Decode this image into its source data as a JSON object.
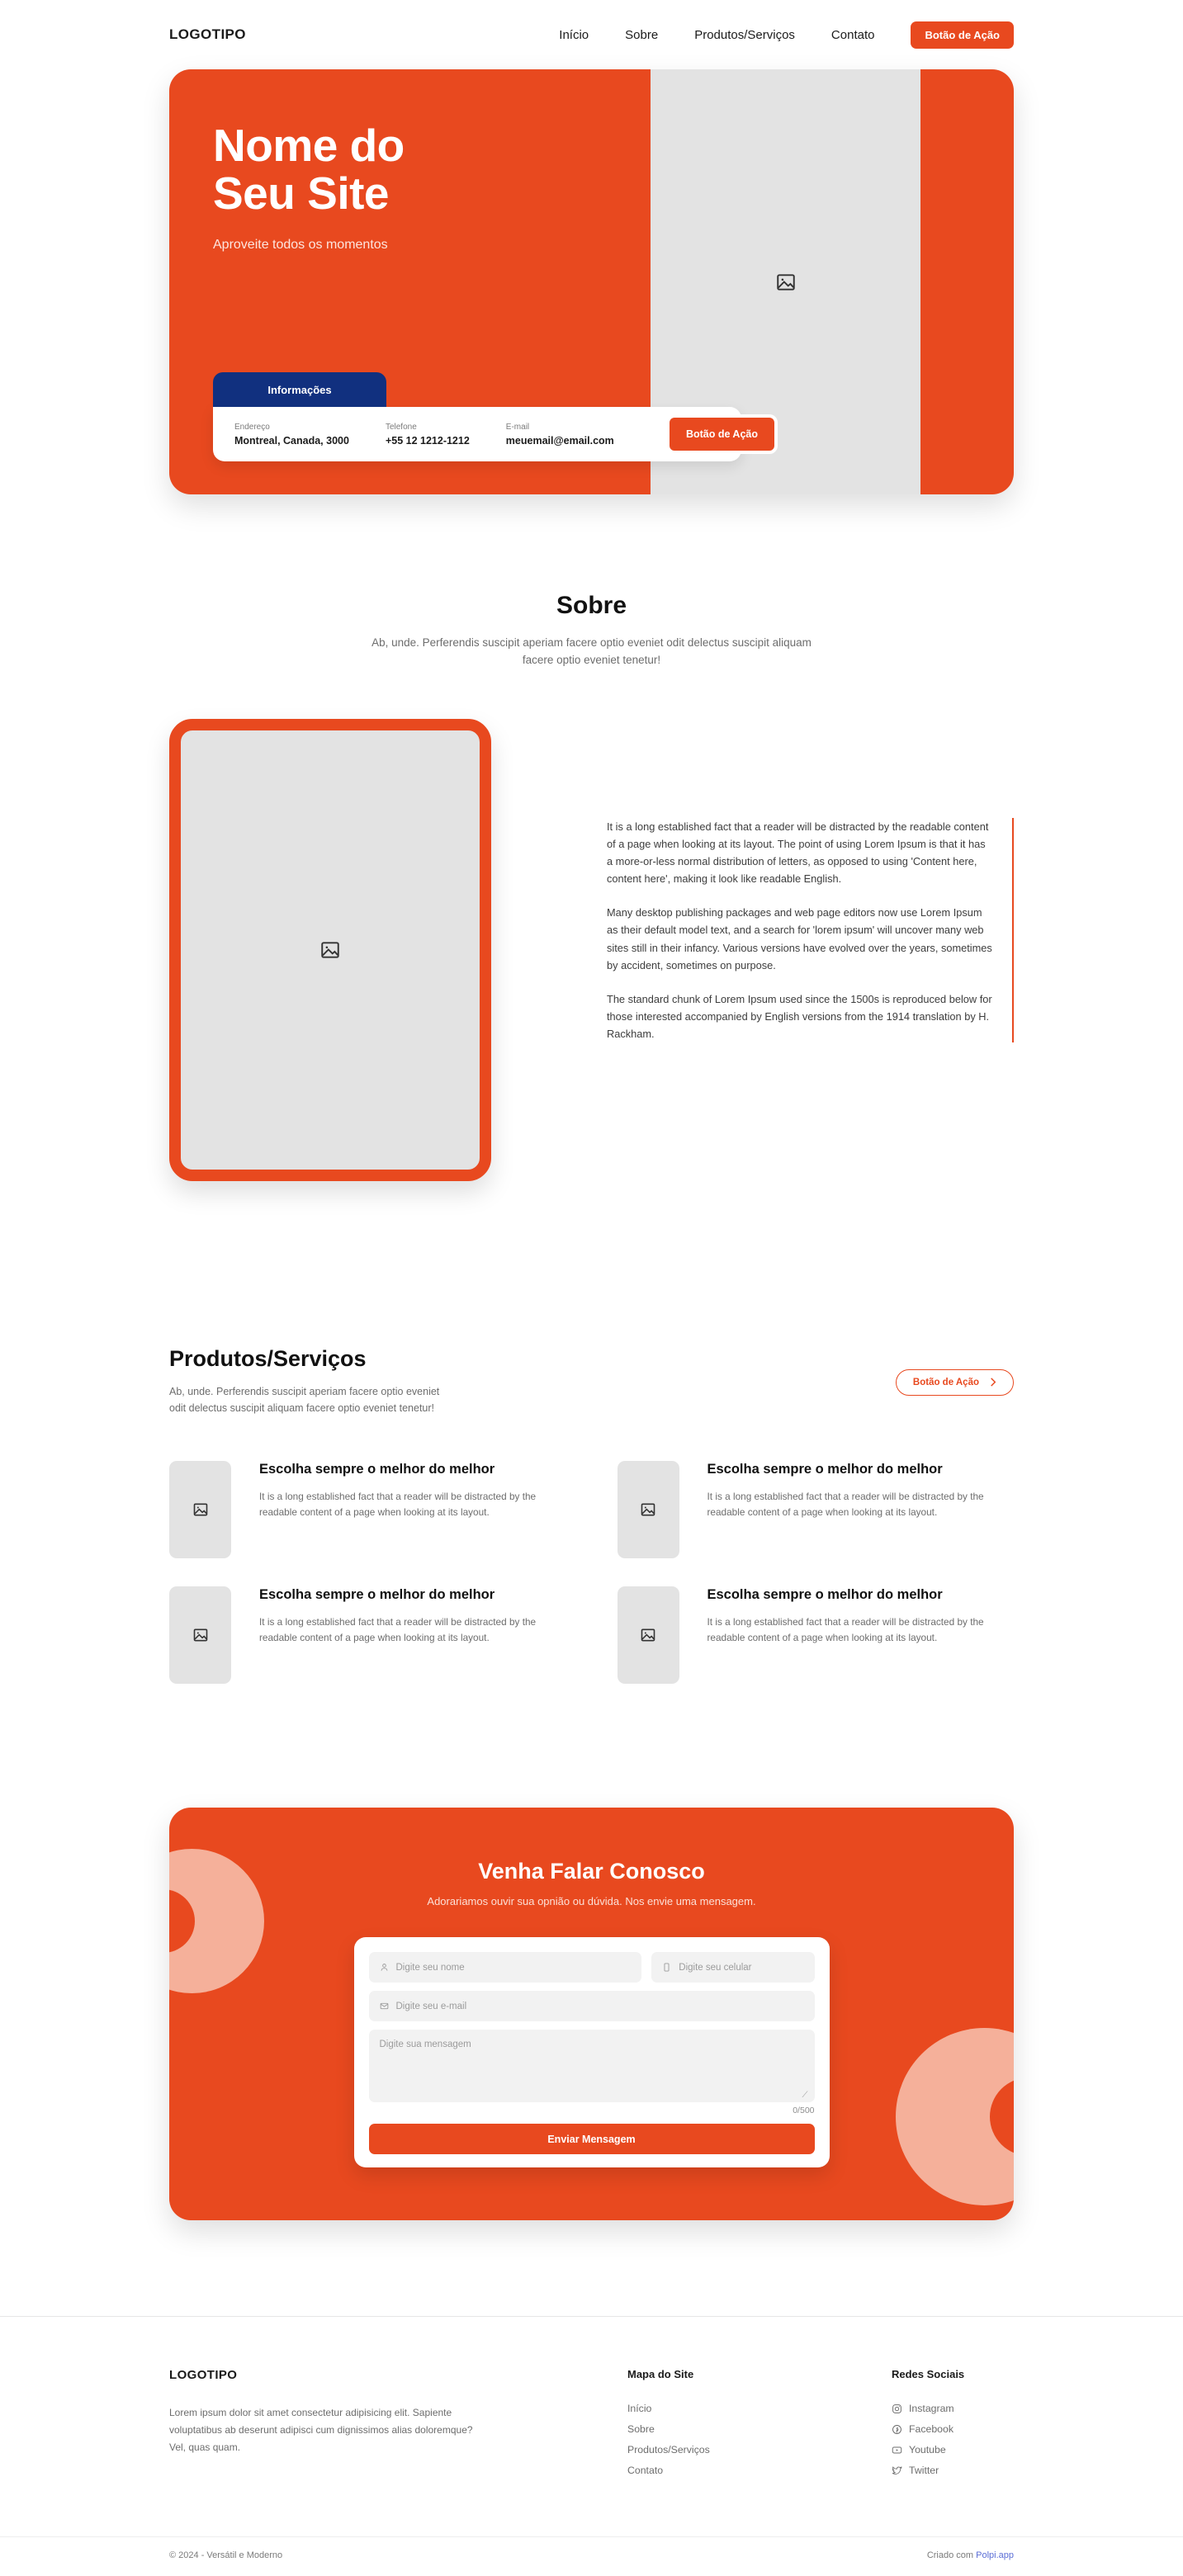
{
  "brand": {
    "accent": "#e8491f",
    "navy": "#11307f",
    "placeholder_gray": "#e3e3e3"
  },
  "header": {
    "logo": "LOGOTIPO",
    "nav": [
      {
        "label": "Início"
      },
      {
        "label": "Sobre"
      },
      {
        "label": "Produtos/Serviços"
      },
      {
        "label": "Contato"
      }
    ],
    "cta_label": "Botão de Ação"
  },
  "hero": {
    "title": "Nome do\nSeu Site",
    "subtitle": "Aproveite todos os momentos",
    "image_icon": "image-placeholder-icon",
    "info_tab_label": "Informações",
    "info_items": [
      {
        "label": "Endereço",
        "value": "Montreal, Canada, 3000"
      },
      {
        "label": "Telefone",
        "value": "+55 12 1212-1212"
      },
      {
        "label": "E-mail",
        "value": "meuemail@email.com"
      }
    ],
    "cta_label": "Botão de Ação"
  },
  "sobre": {
    "title": "Sobre",
    "subtitle": "Ab, unde. Perferendis suscipit aperiam facere optio eveniet odit delectus suscipit aliquam facere optio eveniet tenetur!",
    "image_icon": "image-placeholder-icon",
    "paragraphs": [
      "It is a long established fact that a reader will be distracted by the readable content of a page when looking at its layout. The point of using Lorem Ipsum is that it has a more-or-less normal distribution of letters, as opposed to using 'Content here, content here', making it look like readable English.",
      "Many desktop publishing packages and web page editors now use Lorem Ipsum as their default model text, and a search for 'lorem ipsum' will uncover many web sites still in their infancy. Various versions have evolved over the years, sometimes by accident, sometimes on purpose.",
      "The standard chunk of Lorem Ipsum used since the 1500s is reproduced below for those interested accompanied by English versions from the 1914 translation by H. Rackham."
    ]
  },
  "produtos": {
    "title": "Produtos/Serviços",
    "subtitle": "Ab, unde. Perferendis suscipit aperiam facere optio eveniet odit delectus suscipit aliquam facere optio eveniet tenetur!",
    "cta_label": "Botão de Ação",
    "cards": [
      {
        "title": "Escolha sempre o melhor do melhor",
        "body": "It is a long established fact that a reader will be distracted by the readable content of a page when looking at its layout."
      },
      {
        "title": "Escolha sempre o melhor do melhor",
        "body": "It is a long established fact that a reader will be distracted by the readable content of a page when looking at its layout."
      },
      {
        "title": "Escolha sempre o melhor do melhor",
        "body": "It is a long established fact that a reader will be distracted by the readable content of a page when looking at its layout."
      },
      {
        "title": "Escolha sempre o melhor do melhor",
        "body": "It is a long established fact that a reader will be distracted by the readable content of a page when looking at its layout."
      }
    ]
  },
  "contato": {
    "title": "Venha Falar Conosco",
    "subtitle": "Adorariamos ouvir sua opnião ou dúvida. Nos envie uma mensagem.",
    "fields": {
      "name_placeholder": "Digite seu nome",
      "phone_placeholder": "Digite seu celular",
      "email_placeholder": "Digite seu e-mail",
      "message_placeholder": "Digite sua mensagem"
    },
    "counter": "0/500",
    "submit_label": "Enviar Mensagem"
  },
  "footer": {
    "logo": "LOGOTIPO",
    "description": "Lorem ipsum dolor sit amet consectetur adipisicing elit. Sapiente voluptatibus ab deserunt adipisci cum dignissimos alias doloremque? Vel, quas quam.",
    "sitemap": {
      "heading": "Mapa do Site",
      "links": [
        {
          "label": "Início"
        },
        {
          "label": "Sobre"
        },
        {
          "label": "Produtos/Serviços"
        },
        {
          "label": "Contato"
        }
      ]
    },
    "social": {
      "heading": "Redes Sociais",
      "links": [
        {
          "label": "Instagram",
          "icon": "instagram-icon"
        },
        {
          "label": "Facebook",
          "icon": "facebook-icon"
        },
        {
          "label": "Youtube",
          "icon": "youtube-icon"
        },
        {
          "label": "Twitter",
          "icon": "twitter-icon"
        }
      ]
    },
    "copyright": "© 2024 - Versátil e Moderno",
    "credit_prefix": "Criado com ",
    "credit_link": "Polpi.app"
  }
}
